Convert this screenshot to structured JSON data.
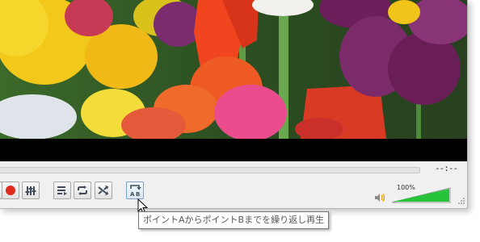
{
  "player": {
    "time_display": "--:--",
    "volume_percent_label": "100%",
    "volume_level": 1.0
  },
  "controls": [
    {
      "name": "record-button",
      "icon": "record-icon"
    },
    {
      "name": "extended-settings-button",
      "icon": "equalizer-sliders-icon"
    },
    {
      "name": "playlist-button",
      "icon": "playlist-icon"
    },
    {
      "name": "loop-button",
      "icon": "loop-icon"
    },
    {
      "name": "random-button",
      "icon": "shuffle-icon"
    },
    {
      "name": "ab-loop-button",
      "icon": "ab-loop-icon",
      "state": "hover"
    }
  ],
  "tooltip": {
    "text": "ポイントAからポイントBまでを繰り返し再生"
  },
  "colors": {
    "record": "#e02b1f",
    "volume_fill": "#27c33a",
    "video_bg": "#000000"
  }
}
